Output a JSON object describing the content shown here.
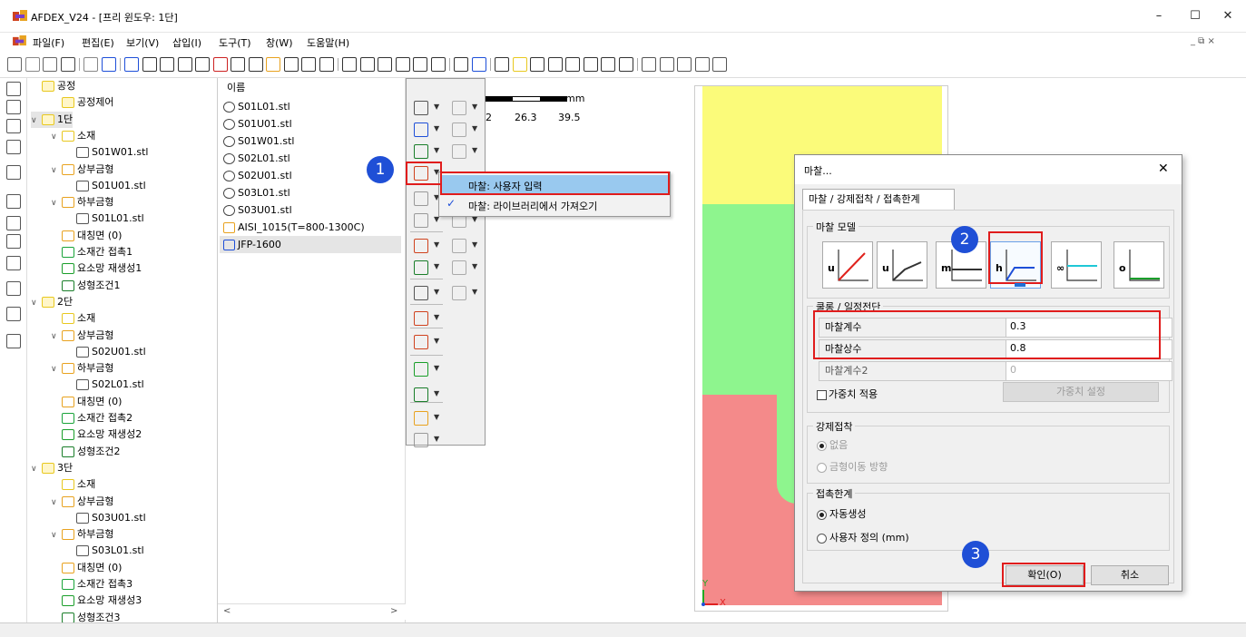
{
  "window": {
    "title": "AFDEX_V24 - [프리 윈도우: 1단]",
    "minimize": "–",
    "maximize": "☐",
    "close": "✕",
    "mdi_controls": "_ ⧉ ×"
  },
  "menu": [
    "파일(F)",
    "편집(E)",
    "보기(V)",
    "삽입(I)",
    "도구(T)",
    "창(W)",
    "도움말(H)"
  ],
  "tree": [
    {
      "label": "공정",
      "level": 0,
      "icon": "folder-icon",
      "chev": ""
    },
    {
      "label": "공정제어",
      "level": 1,
      "icon": "folder-icon",
      "chev": ""
    },
    {
      "label": "1단",
      "level": 0,
      "icon": "folder-icon",
      "chev": "∨",
      "selected": true
    },
    {
      "label": "소재",
      "level": 1,
      "icon": "workpiece-icon",
      "chev": "∨"
    },
    {
      "label": "S01W01.stl",
      "level": 2,
      "icon": "stl-icon",
      "chev": ""
    },
    {
      "label": "상부금형",
      "level": 1,
      "icon": "upper-die-icon",
      "chev": "∨"
    },
    {
      "label": "S01U01.stl",
      "level": 2,
      "icon": "stl-icon",
      "chev": ""
    },
    {
      "label": "하부금형",
      "level": 1,
      "icon": "lower-die-icon",
      "chev": "∨"
    },
    {
      "label": "S01L01.stl",
      "level": 2,
      "icon": "stl-icon",
      "chev": ""
    },
    {
      "label": "대칭면 (0)",
      "level": 1,
      "icon": "symmetry-icon",
      "chev": ""
    },
    {
      "label": "소재간 접촉1",
      "level": 1,
      "icon": "contact-icon",
      "chev": ""
    },
    {
      "label": "요소망 재생성1",
      "level": 1,
      "icon": "mesh-icon",
      "chev": ""
    },
    {
      "label": "성형조건1",
      "level": 1,
      "icon": "condition-icon",
      "chev": ""
    },
    {
      "label": "2단",
      "level": 0,
      "icon": "folder-icon",
      "chev": "∨"
    },
    {
      "label": "소재",
      "level": 1,
      "icon": "workpiece-icon",
      "chev": ""
    },
    {
      "label": "상부금형",
      "level": 1,
      "icon": "upper-die-icon",
      "chev": "∨"
    },
    {
      "label": "S02U01.stl",
      "level": 2,
      "icon": "stl-icon",
      "chev": ""
    },
    {
      "label": "하부금형",
      "level": 1,
      "icon": "lower-die-icon",
      "chev": "∨"
    },
    {
      "label": "S02L01.stl",
      "level": 2,
      "icon": "stl-icon",
      "chev": ""
    },
    {
      "label": "대칭면 (0)",
      "level": 1,
      "icon": "symmetry-icon",
      "chev": ""
    },
    {
      "label": "소재간 접촉2",
      "level": 1,
      "icon": "contact-icon",
      "chev": ""
    },
    {
      "label": "요소망 재생성2",
      "level": 1,
      "icon": "mesh-icon",
      "chev": ""
    },
    {
      "label": "성형조건2",
      "level": 1,
      "icon": "condition-icon",
      "chev": ""
    },
    {
      "label": "3단",
      "level": 0,
      "icon": "folder-icon",
      "chev": "∨"
    },
    {
      "label": "소재",
      "level": 1,
      "icon": "workpiece-icon",
      "chev": ""
    },
    {
      "label": "상부금형",
      "level": 1,
      "icon": "upper-die-icon",
      "chev": "∨"
    },
    {
      "label": "S03U01.stl",
      "level": 2,
      "icon": "stl-icon",
      "chev": ""
    },
    {
      "label": "하부금형",
      "level": 1,
      "icon": "lower-die-icon",
      "chev": "∨"
    },
    {
      "label": "S03L01.stl",
      "level": 2,
      "icon": "stl-icon",
      "chev": ""
    },
    {
      "label": "대칭면 (0)",
      "level": 1,
      "icon": "symmetry-icon",
      "chev": ""
    },
    {
      "label": "소재간 접촉3",
      "level": 1,
      "icon": "contact-icon",
      "chev": ""
    },
    {
      "label": "요소망 재생성3",
      "level": 1,
      "icon": "mesh-icon",
      "chev": ""
    },
    {
      "label": "성형조건3",
      "level": 1,
      "icon": "condition-icon",
      "chev": ""
    }
  ],
  "filelist": {
    "header": "이름",
    "items": [
      "S01L01.stl",
      "S01U01.stl",
      "S01W01.stl",
      "S02L01.stl",
      "S02U01.stl",
      "S03L01.stl",
      "S03U01.stl",
      "AISI_1015(T=800-1300C)",
      "JFP-1600"
    ],
    "scroll_left": "<",
    "scroll_right": ">"
  },
  "popup": {
    "items": [
      "마찰: 사용자 입력",
      "마찰: 라이브러리에서 가져오기"
    ],
    "check": "✓"
  },
  "scale": {
    "unit": "mm",
    "ticks": [
      "2",
      "26.3",
      "39.5"
    ]
  },
  "axes": {
    "y": "Y",
    "x": "X"
  },
  "dialog": {
    "title": "마찰...",
    "close": "✕",
    "tab": "마찰 / 강제접착 / 접촉한계",
    "model_group": "마찰 모델",
    "models": [
      {
        "letter": "u",
        "line": "#e0221c"
      },
      {
        "letter": "u",
        "line": "#333333"
      },
      {
        "letter": "m",
        "line": "#333333"
      },
      {
        "letter": "h",
        "line": "#1e4fd8"
      },
      {
        "letter": "∞",
        "line": "#1fc7d6"
      },
      {
        "letter": "o",
        "line": "#1a9e2a"
      }
    ],
    "coulomb_group": "쿨롱 / 일정전단",
    "params": [
      {
        "label": "마찰계수",
        "value": "0.3"
      },
      {
        "label": "마찰상수",
        "value": "0.8"
      },
      {
        "label": "마찰계수2",
        "value": "0"
      }
    ],
    "weight_check": "가중치 적용",
    "weight_button": "가중치 설정",
    "adhesion_group": "강제접착",
    "adhesion_none": "없음",
    "adhesion_dir": "금형이동 방향",
    "contact_group": "접촉한계",
    "contact_auto": "자동생성",
    "contact_user": "사용자 정의 (mm)",
    "ok": "확인(O)",
    "cancel": "취소"
  },
  "badges": [
    "1",
    "2",
    "3"
  ]
}
